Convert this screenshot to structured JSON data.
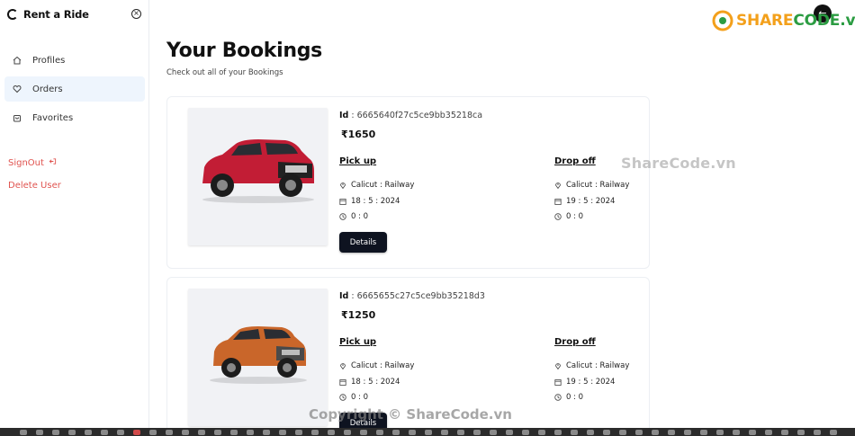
{
  "sidebar": {
    "brand": "Rent a Ride",
    "items": [
      {
        "label": "Profiles",
        "icon": "home-icon"
      },
      {
        "label": "Orders",
        "icon": "heart-icon"
      },
      {
        "label": "Favorites",
        "icon": "bag-icon"
      }
    ],
    "signout": "SignOut",
    "delete_user": "Delete User"
  },
  "header": {
    "title": "Your Bookings",
    "subtitle": "Check out all of your Bookings"
  },
  "labels": {
    "id_label": "Id",
    "pickup": "Pick up",
    "dropoff": "Drop off",
    "details": "Details",
    "currency": "₹"
  },
  "bookings": [
    {
      "id": "6665640f27c5ce9bb35218ca",
      "price": "1650",
      "pickup": {
        "location": "Calicut : Railway",
        "date": "18 : 5 : 2024",
        "time": "0 : 0"
      },
      "dropoff": {
        "location": "Calicut : Railway",
        "date": "19 : 5 : 2024",
        "time": "0 : 0"
      },
      "car_color": "#c21d35"
    },
    {
      "id": "6665655c27c5ce9bb35218d3",
      "price": "1250",
      "pickup": {
        "location": "Calicut : Railway",
        "date": "18 : 5 : 2024",
        "time": "0 : 0"
      },
      "dropoff": {
        "location": "Calicut : Railway",
        "date": "19 : 5 : 2024",
        "time": "0 : 0"
      },
      "car_color": "#c9662a"
    }
  ],
  "watermarks": {
    "logo_text_a": "SHARE",
    "logo_text_b": "CODE.vn",
    "center": "ShareCode.vn",
    "bottom": "Copyright © ShareCode.vn"
  },
  "colors": {
    "accent_active": "#eef5fd",
    "danger": "#e0534f",
    "button_dark": "#0e1320"
  }
}
